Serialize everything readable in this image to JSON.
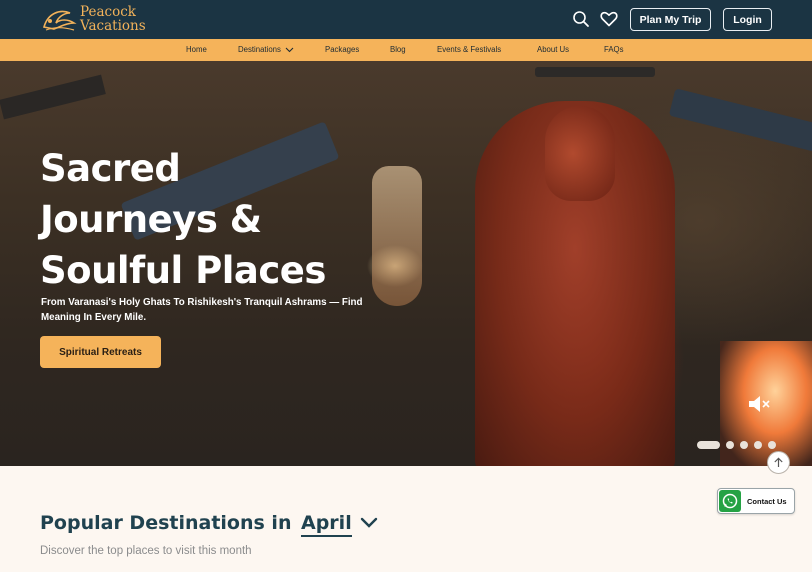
{
  "header": {
    "brand_line1": "Peacock",
    "brand_line2": "Vacations",
    "plan_button": "Plan My Trip",
    "login_button": "Login",
    "icons": [
      "search-icon",
      "heart-icon"
    ]
  },
  "nav": {
    "items": [
      "Home",
      "Destinations",
      "Packages",
      "Blog",
      "Events & Festivals",
      "About Us",
      "FAQs"
    ]
  },
  "hero": {
    "title_line1": "Sacred",
    "title_line2": "Journeys &",
    "title_line3": "Soulful Places",
    "subtitle": "From Varanasi's Holy Ghats To Rishikesh's Tranquil Ashrams — Find Meaning In Every Mile.",
    "cta": "Spiritual Retreats",
    "slide_count": 5,
    "active_slide": 1
  },
  "floating": {
    "whatsapp_label": "Contact Us"
  },
  "popular": {
    "title": "Popular Destinations in",
    "month": "April",
    "subtitle": "Discover the top places to visit this month"
  },
  "colors": {
    "header_bg": "#1b3443",
    "accent": "#f5b35a",
    "heading": "#20424f",
    "page_bg": "#fdf7f1"
  }
}
